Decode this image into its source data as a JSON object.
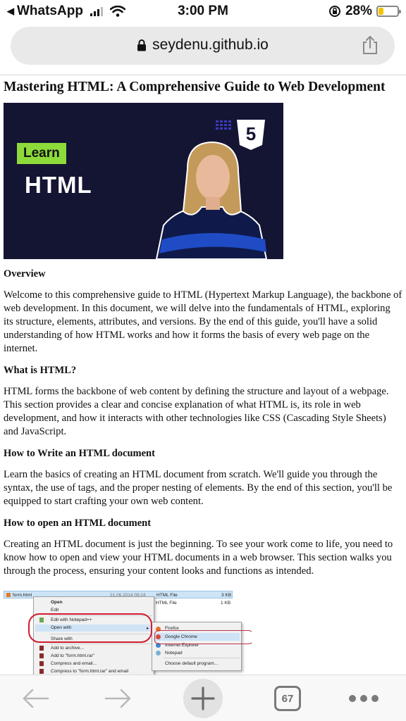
{
  "status_bar": {
    "back_app": "WhatsApp",
    "time": "3:00 PM",
    "battery_percent": "28%",
    "battery_level": 0.28
  },
  "browser": {
    "url": "seydenu.github.io",
    "tab_count": "67"
  },
  "article": {
    "title": "Mastering HTML: A Comprehensive Guide to Web Development",
    "hero": {
      "learn_label": "Learn",
      "html_label": "HTML",
      "badge_number": "5"
    },
    "sections": [
      {
        "heading": "Overview",
        "text": "Welcome to this comprehensive guide to HTML (Hypertext Markup Language), the backbone of web development. In this document, we will delve into the fundamentals of HTML, exploring its structure, elements, attributes, and versions. By the end of this guide, you'll have a solid understanding of how HTML works and how it forms the basis of every web page on the internet."
      },
      {
        "heading": "What is HTML?",
        "text": "HTML forms the backbone of web content by defining the structure and layout of a webpage. This section provides a clear and concise explanation of what HTML is, its role in web development, and how it interacts with other technologies like CSS (Cascading Style Sheets) and JavaScript."
      },
      {
        "heading": "How to Write an HTML document",
        "text": "Learn the basics of creating an HTML document from scratch. We'll guide you through the syntax, the use of tags, and the proper nesting of elements. By the end of this section, you'll be equipped to start crafting your own web content."
      },
      {
        "heading": "How to open an HTML document",
        "text": "Creating an HTML document is just the beginning. To see your work come to life, you need to know how to open and view your HTML documents in a web browser. This section walks you through the process, ensuring your content looks and functions as intended."
      }
    ],
    "screenshot": {
      "file_name": "form.html",
      "file_date": "21.06.2014 09:24",
      "file_type": "HTML File",
      "file_size": "3 KB",
      "row2_type": "HTML File",
      "row2_size": "1 KB",
      "context_menu": [
        "Open",
        "Edit",
        "Edit with Notepad++",
        "Open with",
        "Share with",
        "Add to archive...",
        "Add to \"form.html.rar\"",
        "Compress and email...",
        "Compress to \"form.html.rar\" and email"
      ],
      "open_with_menu": [
        "Firefox",
        "Google Chrome",
        "Internet Explorer",
        "Notepad",
        "Choose default program..."
      ]
    }
  },
  "colors": {
    "hero_bg": "#141433",
    "learn_badge": "#8ddb3a",
    "annotation_red": "#d01e2e",
    "battery_yellow": "#f2c500"
  }
}
